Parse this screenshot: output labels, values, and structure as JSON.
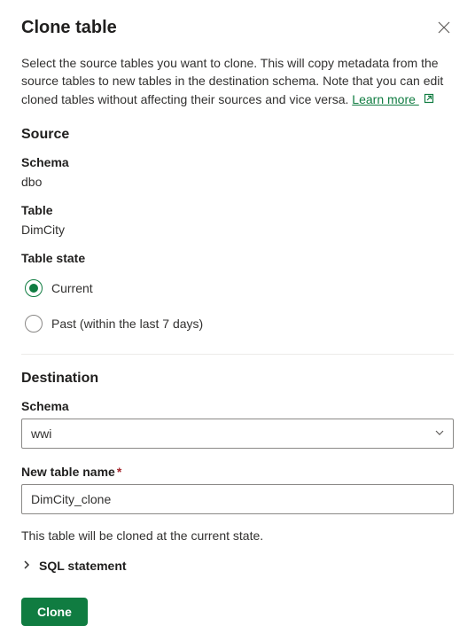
{
  "dialog": {
    "title": "Clone table",
    "description": "Select the source tables you want to clone. This will copy metadata from the source tables to new tables in the destination schema. Note that you can edit cloned tables without affecting their sources and vice versa. ",
    "learn_more": "Learn more "
  },
  "source": {
    "section_title": "Source",
    "schema_label": "Schema",
    "schema_value": "dbo",
    "table_label": "Table",
    "table_value": "DimCity",
    "table_state_label": "Table state",
    "state_options": {
      "current": "Current",
      "past": "Past (within the last 7 days)"
    },
    "selected_state": "current"
  },
  "destination": {
    "section_title": "Destination",
    "schema_label": "Schema",
    "schema_value": "wwi",
    "new_table_label": "New table name",
    "new_table_value": "DimCity_clone"
  },
  "footer": {
    "info_text": "This table will be cloned at the current state.",
    "sql_expander": "SQL statement",
    "clone_button": "Clone"
  }
}
